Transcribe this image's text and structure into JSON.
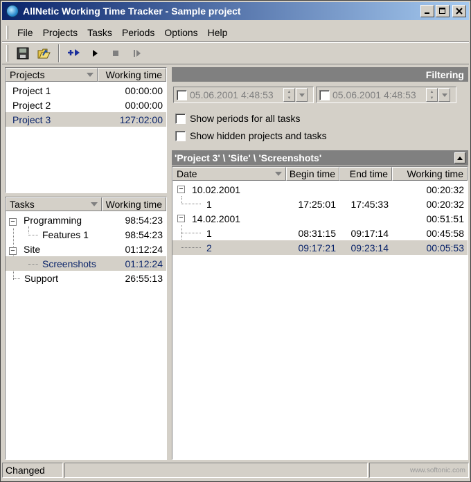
{
  "window": {
    "title": "AllNetic Working Time Tracker - Sample project",
    "buttons": {
      "minimize": "_",
      "maximize": "□",
      "close": "X"
    }
  },
  "menu": [
    "File",
    "Projects",
    "Tasks",
    "Periods",
    "Options",
    "Help"
  ],
  "toolbar": {
    "buttons": [
      "save-icon",
      "open-icon",
      "add-period-icon",
      "play-icon",
      "stop-icon",
      "pause-icon"
    ]
  },
  "projects": {
    "headers": {
      "name": "Projects",
      "time": "Working time"
    },
    "rows": [
      {
        "name": "Project 1",
        "time": "00:00:00"
      },
      {
        "name": "Project 2",
        "time": "00:00:00"
      },
      {
        "name": "Project 3",
        "time": "127:02:00",
        "selected": true
      }
    ]
  },
  "tasks": {
    "headers": {
      "name": "Tasks",
      "time": "Working time"
    },
    "rows": [
      {
        "name": "Programming",
        "time": "98:54:23"
      },
      {
        "name": "Features 1",
        "time": "98:54:23"
      },
      {
        "name": "Site",
        "time": "01:12:24"
      },
      {
        "name": "Screenshots",
        "time": "01:12:24",
        "selected": true
      },
      {
        "name": "Support",
        "time": "26:55:13"
      }
    ]
  },
  "filtering": {
    "title": "Filtering",
    "from": "05.06.2001 4:48:53",
    "to": "05.06.2001 4:48:53",
    "show_all_periods": "Show periods for all tasks",
    "show_hidden": "Show hidden projects and tasks"
  },
  "periods": {
    "path": "'Project 3' \\ 'Site' \\ 'Screenshots'",
    "headers": {
      "date": "Date",
      "begin": "Begin time",
      "end": "End time",
      "time": "Working time"
    },
    "rows": [
      {
        "date": "10.02.2001",
        "begin": "",
        "end": "",
        "time": "00:20:32"
      },
      {
        "date": "1",
        "begin": "17:25:01",
        "end": "17:45:33",
        "time": "00:20:32"
      },
      {
        "date": "14.02.2001",
        "begin": "",
        "end": "",
        "time": "00:51:51"
      },
      {
        "date": "1",
        "begin": "08:31:15",
        "end": "09:17:14",
        "time": "00:45:58"
      },
      {
        "date": "2",
        "begin": "09:17:21",
        "end": "09:23:14",
        "time": "00:05:53",
        "selected": true
      }
    ]
  },
  "status": {
    "text": "Changed"
  },
  "watermark": "www.softonic.com"
}
